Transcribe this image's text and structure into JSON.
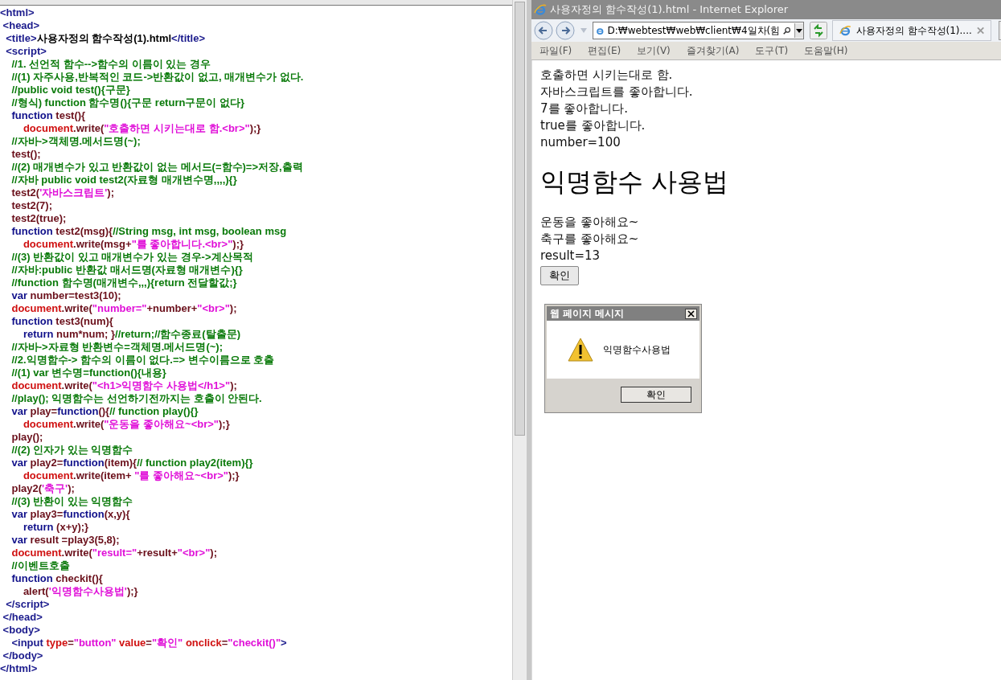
{
  "editor": {
    "lines": [
      {
        "tokens": [
          {
            "kind": "tag",
            "text": "<html>"
          }
        ]
      },
      {
        "tokens": [
          {
            "kind": "tag",
            "text": " <head>"
          }
        ]
      },
      {
        "tokens": [
          {
            "kind": "tag",
            "text": "  <title>"
          },
          {
            "kind": "text",
            "text": "사용자정의 함수작성(1).html"
          },
          {
            "kind": "tag",
            "text": "</title>"
          }
        ]
      },
      {
        "tokens": [
          {
            "kind": "tag",
            "text": "  <script>"
          }
        ]
      },
      {
        "tokens": [
          {
            "kind": "comment",
            "text": "    //1. 선언적 함수-->함수의 이름이 있는 경우"
          }
        ]
      },
      {
        "tokens": [
          {
            "kind": "comment",
            "text": "    //(1) 자주사용,반복적인 코드->반환값이 없고, 매개변수가 없다."
          }
        ]
      },
      {
        "tokens": [
          {
            "kind": "comment",
            "text": "    //public void test(){구문}"
          }
        ]
      },
      {
        "tokens": [
          {
            "kind": "comment",
            "text": "    //형식) function 함수명(){구문 return구문이 없다}"
          }
        ]
      },
      {
        "tokens": [
          {
            "kind": "keyword",
            "text": "    function"
          },
          {
            "kind": "ident",
            "text": " test(){"
          }
        ]
      },
      {
        "tokens": [
          {
            "kind": "object",
            "text": "        document"
          },
          {
            "kind": "ident",
            "text": ".write("
          },
          {
            "kind": "string",
            "text": "\"호출하면 시키는대로 함.<br>\""
          },
          {
            "kind": "ident",
            "text": ");}"
          }
        ]
      },
      {
        "tokens": [
          {
            "kind": "comment",
            "text": "    //자바->객체명.메서드명(~);"
          }
        ]
      },
      {
        "tokens": [
          {
            "kind": "ident",
            "text": "    test();"
          }
        ]
      },
      {
        "tokens": [
          {
            "kind": "comment",
            "text": "    //(2) 매개변수가 있고 반환값이 없는 메서드(=함수)=>저장,출력"
          }
        ]
      },
      {
        "tokens": [
          {
            "kind": "comment",
            "text": "    //자바 public void test2(자료형 매개변수명,,,,){}"
          }
        ]
      },
      {
        "tokens": [
          {
            "kind": "ident",
            "text": "    test2("
          },
          {
            "kind": "string",
            "text": "'자바스크립트'"
          },
          {
            "kind": "ident",
            "text": ");"
          }
        ]
      },
      {
        "tokens": [
          {
            "kind": "ident",
            "text": "    test2(7);"
          }
        ]
      },
      {
        "tokens": [
          {
            "kind": "ident",
            "text": "    test2(true);"
          }
        ]
      },
      {
        "tokens": [
          {
            "kind": "keyword",
            "text": "    function"
          },
          {
            "kind": "ident",
            "text": " test2(msg){"
          },
          {
            "kind": "comment",
            "text": "//String msg, int msg, boolean msg"
          }
        ]
      },
      {
        "tokens": [
          {
            "kind": "object",
            "text": "        document"
          },
          {
            "kind": "ident",
            "text": ".write(msg+"
          },
          {
            "kind": "string",
            "text": "\"를 좋아합니다.<br>\""
          },
          {
            "kind": "ident",
            "text": ");}"
          }
        ]
      },
      {
        "tokens": [
          {
            "kind": "comment",
            "text": "    //(3) 반환값이 있고 매개변수가 있는 경우->계산목적"
          }
        ]
      },
      {
        "tokens": [
          {
            "kind": "comment",
            "text": "    //자바:public 반환값 매서드명(자료형 매개변수){}"
          }
        ]
      },
      {
        "tokens": [
          {
            "kind": "comment",
            "text": "    //function 함수명(매개변수,,,){return 전달할값;}"
          }
        ]
      },
      {
        "tokens": [
          {
            "kind": "keyword",
            "text": "    var"
          },
          {
            "kind": "ident",
            "text": " number=test3(10);"
          }
        ]
      },
      {
        "tokens": [
          {
            "kind": "object",
            "text": "    document"
          },
          {
            "kind": "ident",
            "text": ".write("
          },
          {
            "kind": "string",
            "text": "\"number=\""
          },
          {
            "kind": "ident",
            "text": "+number+"
          },
          {
            "kind": "string",
            "text": "\"<br>\""
          },
          {
            "kind": "ident",
            "text": ");"
          }
        ]
      },
      {
        "tokens": [
          {
            "kind": "keyword",
            "text": "    function"
          },
          {
            "kind": "ident",
            "text": " test3(num){"
          }
        ]
      },
      {
        "tokens": [
          {
            "kind": "keyword",
            "text": "        return"
          },
          {
            "kind": "ident",
            "text": " num*num; }"
          },
          {
            "kind": "comment",
            "text": "//return;//함수종료(탈출문)"
          }
        ]
      },
      {
        "tokens": [
          {
            "kind": "comment",
            "text": "    //자바->자료형 반환변수=객체명.메서드명(~);"
          }
        ]
      },
      {
        "tokens": [
          {
            "kind": "comment",
            "text": "    //2.익명함수-> 함수의 이름이 없다.=> 변수이름으로 호출"
          }
        ]
      },
      {
        "tokens": [
          {
            "kind": "comment",
            "text": "    //(1) var 변수명=function(){내용}"
          }
        ]
      },
      {
        "tokens": [
          {
            "kind": "object",
            "text": "    document"
          },
          {
            "kind": "ident",
            "text": ".write("
          },
          {
            "kind": "string",
            "text": "\"<h1>익명함수 사용법</h1>\""
          },
          {
            "kind": "ident",
            "text": ");"
          }
        ]
      },
      {
        "tokens": [
          {
            "kind": "comment",
            "text": "    //play(); 익명함수는 선언하기전까지는 호출이 안된다."
          }
        ]
      },
      {
        "tokens": [
          {
            "kind": "keyword",
            "text": "    var"
          },
          {
            "kind": "ident",
            "text": " play="
          },
          {
            "kind": "keyword",
            "text": "function"
          },
          {
            "kind": "ident",
            "text": "(){"
          },
          {
            "kind": "comment",
            "text": "// function play(){}"
          }
        ]
      },
      {
        "tokens": [
          {
            "kind": "object",
            "text": "        document"
          },
          {
            "kind": "ident",
            "text": ".write("
          },
          {
            "kind": "string",
            "text": "\"운동을 좋아해요~<br>\""
          },
          {
            "kind": "ident",
            "text": ");}"
          }
        ]
      },
      {
        "tokens": [
          {
            "kind": "ident",
            "text": "    play();"
          }
        ]
      },
      {
        "tokens": [
          {
            "kind": "comment",
            "text": "    //(2) 인자가 있는 익명함수"
          }
        ]
      },
      {
        "tokens": [
          {
            "kind": "keyword",
            "text": "    var"
          },
          {
            "kind": "ident",
            "text": " play2="
          },
          {
            "kind": "keyword",
            "text": "function"
          },
          {
            "kind": "ident",
            "text": "(item){"
          },
          {
            "kind": "comment",
            "text": "// function play2(item){}"
          }
        ]
      },
      {
        "tokens": [
          {
            "kind": "object",
            "text": "        document"
          },
          {
            "kind": "ident",
            "text": ".write(item+ "
          },
          {
            "kind": "string",
            "text": "\"를 좋아해요~<br>\""
          },
          {
            "kind": "ident",
            "text": ");}"
          }
        ]
      },
      {
        "tokens": [
          {
            "kind": "ident",
            "text": "    play2("
          },
          {
            "kind": "string",
            "text": "'축구'"
          },
          {
            "kind": "ident",
            "text": ");"
          }
        ]
      },
      {
        "tokens": [
          {
            "kind": "comment",
            "text": "    //(3) 반환이 있는 익명함수"
          }
        ]
      },
      {
        "tokens": [
          {
            "kind": "keyword",
            "text": "    var"
          },
          {
            "kind": "ident",
            "text": " play3="
          },
          {
            "kind": "keyword",
            "text": "function"
          },
          {
            "kind": "ident",
            "text": "(x,y){"
          }
        ]
      },
      {
        "tokens": [
          {
            "kind": "keyword",
            "text": "        return"
          },
          {
            "kind": "ident",
            "text": " (x+y);}"
          }
        ]
      },
      {
        "tokens": [
          {
            "kind": "keyword",
            "text": "    var"
          },
          {
            "kind": "ident",
            "text": " result =play3(5,8);"
          }
        ]
      },
      {
        "tokens": [
          {
            "kind": "object",
            "text": "    document"
          },
          {
            "kind": "ident",
            "text": ".write("
          },
          {
            "kind": "string",
            "text": "\"result=\""
          },
          {
            "kind": "ident",
            "text": "+result+"
          },
          {
            "kind": "string",
            "text": "\"<br>\""
          },
          {
            "kind": "ident",
            "text": ");"
          }
        ]
      },
      {
        "tokens": [
          {
            "kind": "comment",
            "text": "    //이벤트호출"
          }
        ]
      },
      {
        "tokens": [
          {
            "kind": "keyword",
            "text": "    function"
          },
          {
            "kind": "ident",
            "text": " checkit(){"
          }
        ]
      },
      {
        "tokens": [
          {
            "kind": "ident",
            "text": "        alert("
          },
          {
            "kind": "string",
            "text": "'익명함수사용법'"
          },
          {
            "kind": "ident",
            "text": ");}"
          }
        ]
      },
      {
        "tokens": [
          {
            "kind": "tag",
            "text": "  </script>"
          }
        ]
      },
      {
        "tokens": [
          {
            "kind": "tag",
            "text": " </head>"
          }
        ]
      },
      {
        "tokens": [
          {
            "kind": "tag",
            "text": " <body>"
          }
        ]
      },
      {
        "tokens": [
          {
            "kind": "tag",
            "text": "    <input"
          },
          {
            "kind": "object",
            "text": " type"
          },
          {
            "kind": "ident",
            "text": "="
          },
          {
            "kind": "string",
            "text": "\"button\""
          },
          {
            "kind": "object",
            "text": " value"
          },
          {
            "kind": "ident",
            "text": "="
          },
          {
            "kind": "string",
            "text": "\"확인\""
          },
          {
            "kind": "object",
            "text": " onclick"
          },
          {
            "kind": "ident",
            "text": "="
          },
          {
            "kind": "string",
            "text": "\"checkit()\""
          },
          {
            "kind": "tag",
            "text": ">"
          }
        ]
      },
      {
        "tokens": [
          {
            "kind": "tag",
            "text": " </body>"
          }
        ]
      },
      {
        "tokens": [
          {
            "kind": "tag",
            "text": "</html>"
          }
        ]
      }
    ]
  },
  "browser": {
    "title": "사용자정의 함수작성(1).html - Internet Explorer",
    "address": "D:₩webtest₩web₩client₩4일차(힘",
    "tab": {
      "title": "사용자정의 함수작성(1)...."
    },
    "menu": [
      "파일(F)",
      "편집(E)",
      "보기(V)",
      "즐겨찾기(A)",
      "도구(T)",
      "도움말(H)"
    ],
    "page": {
      "lines_before": [
        "호출하면 시키는대로 함.",
        "자바스크립트를 좋아합니다.",
        "7를 좋아합니다.",
        "true를 좋아합니다.",
        "number=100"
      ],
      "heading": "익명함수 사용법",
      "lines_after": [
        "운동을 좋아해요~",
        "축구를 좋아해요~",
        "result=13"
      ],
      "button": "확인"
    },
    "dialog": {
      "title": "웹 페이지 메시지",
      "message": "익명함수사용법",
      "button": "확인"
    }
  }
}
